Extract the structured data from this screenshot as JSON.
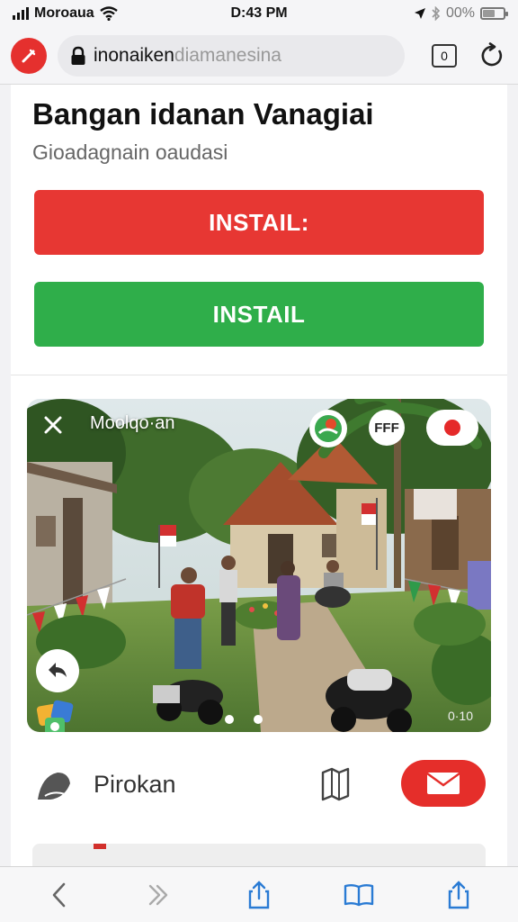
{
  "status_bar": {
    "carrier": "Moroaua",
    "time": "D:43 PM",
    "battery_percent": "00%",
    "battery_level": 0.6
  },
  "browser": {
    "url_main": "inonaiken",
    "url_faded": "diamanesina",
    "tab_count": "0"
  },
  "page": {
    "title": "Bangan idanan Vanagiai",
    "subtitle": "Gioadagnain oaudasi",
    "install_red_label": "INSTAIL:",
    "install_green_label": "INSTAIL"
  },
  "media": {
    "caption": "Moolqo·an",
    "badge": "FFF",
    "counter": "0·10",
    "page_dots": 2
  },
  "author": {
    "name": "Pirokan"
  },
  "colors": {
    "accent_red": "#e73733",
    "accent_green": "#2fae4a",
    "toolbar_icon": "#2a7bd4"
  },
  "icons": {
    "status": [
      "signal-icon",
      "wifi-icon",
      "location-icon",
      "bluetooth-icon",
      "battery-icon"
    ],
    "address_bar": [
      "site-logo-icon",
      "lock-icon",
      "tabs-icon",
      "reload-icon"
    ],
    "toolbar": [
      "back-icon",
      "forward-icon",
      "share-icon",
      "bookmarks-icon",
      "share-out-icon"
    ]
  }
}
